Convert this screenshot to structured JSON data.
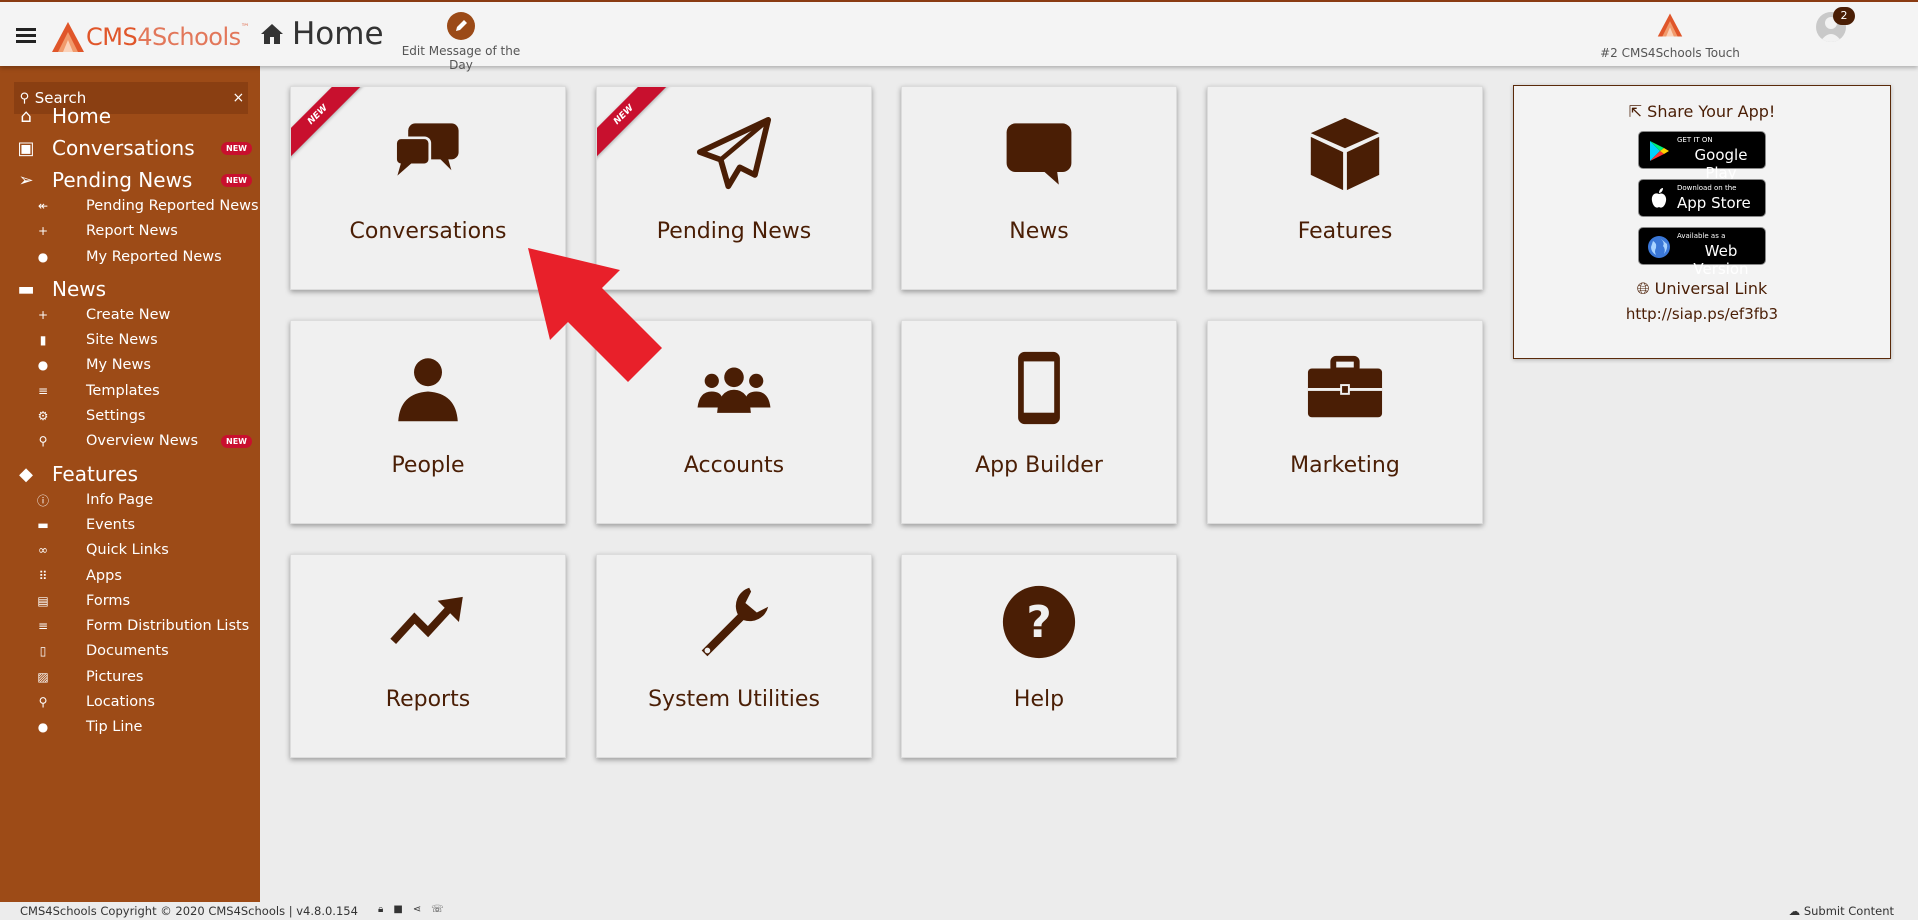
{
  "app": {
    "logo_cms": "CMS",
    "logo_4schools": "4Schools",
    "logo_tm": "™",
    "page_title": "Home"
  },
  "header": {
    "motd_label": "Edit Message of the Day",
    "touch_label": "#2 CMS4Schools Touch",
    "notification_count": "2"
  },
  "search": {
    "placeholder": "Search",
    "clear": "×"
  },
  "sidebar": {
    "badge_new": "NEW",
    "items": [
      {
        "label": "Home",
        "icon": "home-icon",
        "level": "top"
      },
      {
        "label": "Conversations",
        "icon": "conversations-icon",
        "level": "top",
        "new": true
      },
      {
        "label": "Pending News",
        "icon": "paper-plane-icon",
        "level": "top",
        "new": true
      },
      {
        "label": "Pending Reported News",
        "icon": "reply-all-icon",
        "level": "sub"
      },
      {
        "label": "Report News",
        "icon": "plus-icon",
        "level": "sub"
      },
      {
        "label": "My Reported News",
        "icon": "user-icon",
        "level": "sub"
      },
      {
        "label": "News",
        "icon": "comment-icon",
        "level": "top"
      },
      {
        "label": "Create New",
        "icon": "plus-icon",
        "level": "sub"
      },
      {
        "label": "Site News",
        "icon": "building-icon",
        "level": "sub"
      },
      {
        "label": "My News",
        "icon": "user-icon",
        "level": "sub"
      },
      {
        "label": "Templates",
        "icon": "list-icon",
        "level": "sub"
      },
      {
        "label": "Settings",
        "icon": "gear-icon",
        "level": "sub"
      },
      {
        "label": "Overview News",
        "icon": "search-icon",
        "level": "sub",
        "new": true
      },
      {
        "label": "Features",
        "icon": "cube-icon",
        "level": "top"
      },
      {
        "label": "Info Page",
        "icon": "info-icon",
        "level": "sub"
      },
      {
        "label": "Events",
        "icon": "calendar-icon",
        "level": "sub"
      },
      {
        "label": "Quick Links",
        "icon": "link-icon",
        "level": "sub"
      },
      {
        "label": "Apps",
        "icon": "grid-icon",
        "level": "sub"
      },
      {
        "label": "Forms",
        "icon": "clipboard-icon",
        "level": "sub"
      },
      {
        "label": "Form Distribution Lists",
        "icon": "list-icon",
        "level": "sub"
      },
      {
        "label": "Documents",
        "icon": "document-icon",
        "level": "sub"
      },
      {
        "label": "Pictures",
        "icon": "picture-icon",
        "level": "sub"
      },
      {
        "label": "Locations",
        "icon": "map-pin-icon",
        "level": "sub"
      },
      {
        "label": "Tip Line",
        "icon": "chat-icon",
        "level": "sub"
      }
    ]
  },
  "tiles": {
    "ribbon_label": "NEW",
    "items": [
      {
        "label": "Conversations",
        "icon": "conversations-icon",
        "new": true
      },
      {
        "label": "Pending News",
        "icon": "paper-plane-icon",
        "new": true
      },
      {
        "label": "News",
        "icon": "comment-icon"
      },
      {
        "label": "Features",
        "icon": "cube-icon"
      },
      {
        "label": "People",
        "icon": "user-icon"
      },
      {
        "label": "Accounts",
        "icon": "users-icon"
      },
      {
        "label": "App Builder",
        "icon": "tablet-icon"
      },
      {
        "label": "Marketing",
        "icon": "briefcase-icon"
      },
      {
        "label": "Reports",
        "icon": "trend-up-icon"
      },
      {
        "label": "System Utilities",
        "icon": "wrench-icon"
      },
      {
        "label": "Help",
        "icon": "question-circle-icon"
      }
    ]
  },
  "share": {
    "title": "Share Your App!",
    "google_small": "GET IT ON",
    "google_big": "Google Play",
    "apple_small": "Download on the",
    "apple_big": "App Store",
    "web_small": "Available as a",
    "web_big": "Web Version",
    "universal_title": "Universal Link",
    "universal_url": "http://siap.ps/ef3fb3"
  },
  "footer": {
    "copyright": "CMS4Schools Copyright © 2020 CMS4Schools | v4.8.0.154",
    "submit": "Submit Content"
  },
  "colors": {
    "sidebar": "#9d4b17",
    "accent_dark": "#4a1e05",
    "badge": "#c8102e",
    "logo": "#e0562a",
    "arrow": "#e8202a"
  }
}
